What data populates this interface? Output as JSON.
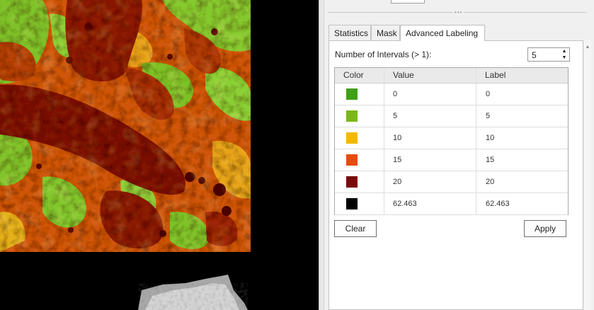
{
  "tabs": [
    {
      "label": "Statistics",
      "active": false
    },
    {
      "label": "Mask",
      "active": false
    },
    {
      "label": "Advanced Labeling",
      "active": true
    }
  ],
  "intervals": {
    "label": "Number of Intervals (> 1):",
    "value": "5"
  },
  "table": {
    "headers": [
      "Color",
      "Value",
      "Label"
    ],
    "rows": [
      {
        "color": "#3fa014",
        "value": "0",
        "label": "0"
      },
      {
        "color": "#7ab818",
        "value": "5",
        "label": "5"
      },
      {
        "color": "#f5b800",
        "value": "10",
        "label": "10"
      },
      {
        "color": "#e94a10",
        "value": "15",
        "label": "15"
      },
      {
        "color": "#7a0a0a",
        "value": "20",
        "label": "20"
      },
      {
        "color": "#000000",
        "value": "62.463",
        "label": "62.463"
      }
    ]
  },
  "buttons": {
    "clear": "Clear",
    "apply": "Apply"
  },
  "icons": {
    "stepper_up": "▲",
    "stepper_down": "▼",
    "scroll_up": "▲",
    "grip": "•••"
  }
}
